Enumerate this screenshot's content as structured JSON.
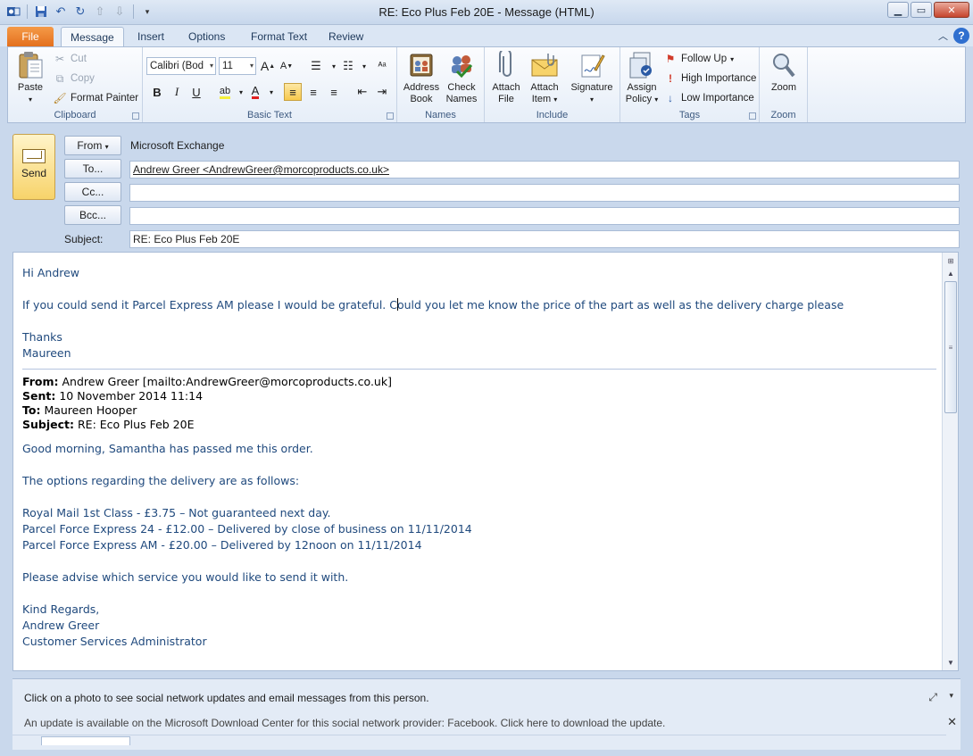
{
  "window": {
    "title": "RE: Eco Plus Feb 20E - Message (HTML)"
  },
  "tabs": [
    "File",
    "Message",
    "Insert",
    "Options",
    "Format Text",
    "Review"
  ],
  "ribbon": {
    "clipboard": {
      "label": "Clipboard",
      "paste": "Paste",
      "cut": "Cut",
      "copy": "Copy",
      "format_painter": "Format Painter"
    },
    "basic_text": {
      "label": "Basic Text",
      "font": "Calibri (Body)",
      "font_short": "Calibri (Bod",
      "size": "11"
    },
    "names": {
      "label": "Names",
      "address_book_1": "Address",
      "address_book_2": "Book",
      "check_names_1": "Check",
      "check_names_2": "Names"
    },
    "include": {
      "label": "Include",
      "attach_file_1": "Attach",
      "attach_file_2": "File",
      "attach_item_1": "Attach",
      "attach_item_2": "Item",
      "signature": "Signature"
    },
    "tags": {
      "label": "Tags",
      "assign_policy_1": "Assign",
      "assign_policy_2": "Policy",
      "follow_up": "Follow Up",
      "high_importance": "High Importance",
      "low_importance": "Low Importance"
    },
    "zoom": {
      "label": "Zoom",
      "zoom": "Zoom"
    }
  },
  "header": {
    "send": "Send",
    "from_button": "From",
    "from_account": "Microsoft Exchange",
    "to_button": "To...",
    "to_value": "Andrew Greer <AndrewGreer@morcoproducts.co.uk>",
    "cc_button": "Cc...",
    "cc_value": "",
    "bcc_button": "Bcc...",
    "bcc_value": "",
    "subject_label": "Subject:",
    "subject_value": "RE: Eco Plus Feb 20E"
  },
  "body": {
    "greeting": "Hi Andrew",
    "line1_a": "If you could send it Parcel Express AM please I would be grateful. C",
    "line1_b": "ould you let me know the price of the part as well as the delivery charge please",
    "thanks": "Thanks",
    "signature": "Maureen",
    "quoted": {
      "from_label": "From:",
      "from_value": "Andrew Greer [mailto:AndrewGreer@morcoproducts.co.uk]",
      "sent_label": "Sent:",
      "sent_value": "10 November 2014 11:14",
      "to_label": "To:",
      "to_value": "Maureen Hooper",
      "subject_label": "Subject:",
      "subject_value": "RE: Eco Plus Feb 20E",
      "intro": "Good morning, Samantha has passed me this order.",
      "options_intro": "The options regarding the delivery are as follows:",
      "option1": "Royal Mail 1st Class - £3.75 – Not guaranteed next day.",
      "option2": "Parcel Force Express 24 - £12.00 – Delivered by close of business on 11/11/2014",
      "option3": "Parcel Force Express AM - £20.00 – Delivered by 12noon on 11/11/2014",
      "advise": "Please advise which service you would like to send it with.",
      "regards": "Kind Regards,",
      "name": "Andrew Greer",
      "role": "Customer Services Administrator"
    }
  },
  "people_pane": {
    "message": "Click on a photo to see social network updates and email messages from this person.",
    "update_notice": "An update is available on the Microsoft Download Center for this social network provider: Facebook. Click here to download the update."
  },
  "colors": {
    "accent": "#2a5aa5",
    "file_tab": "#e3701d",
    "body_text": "#1f497d"
  }
}
